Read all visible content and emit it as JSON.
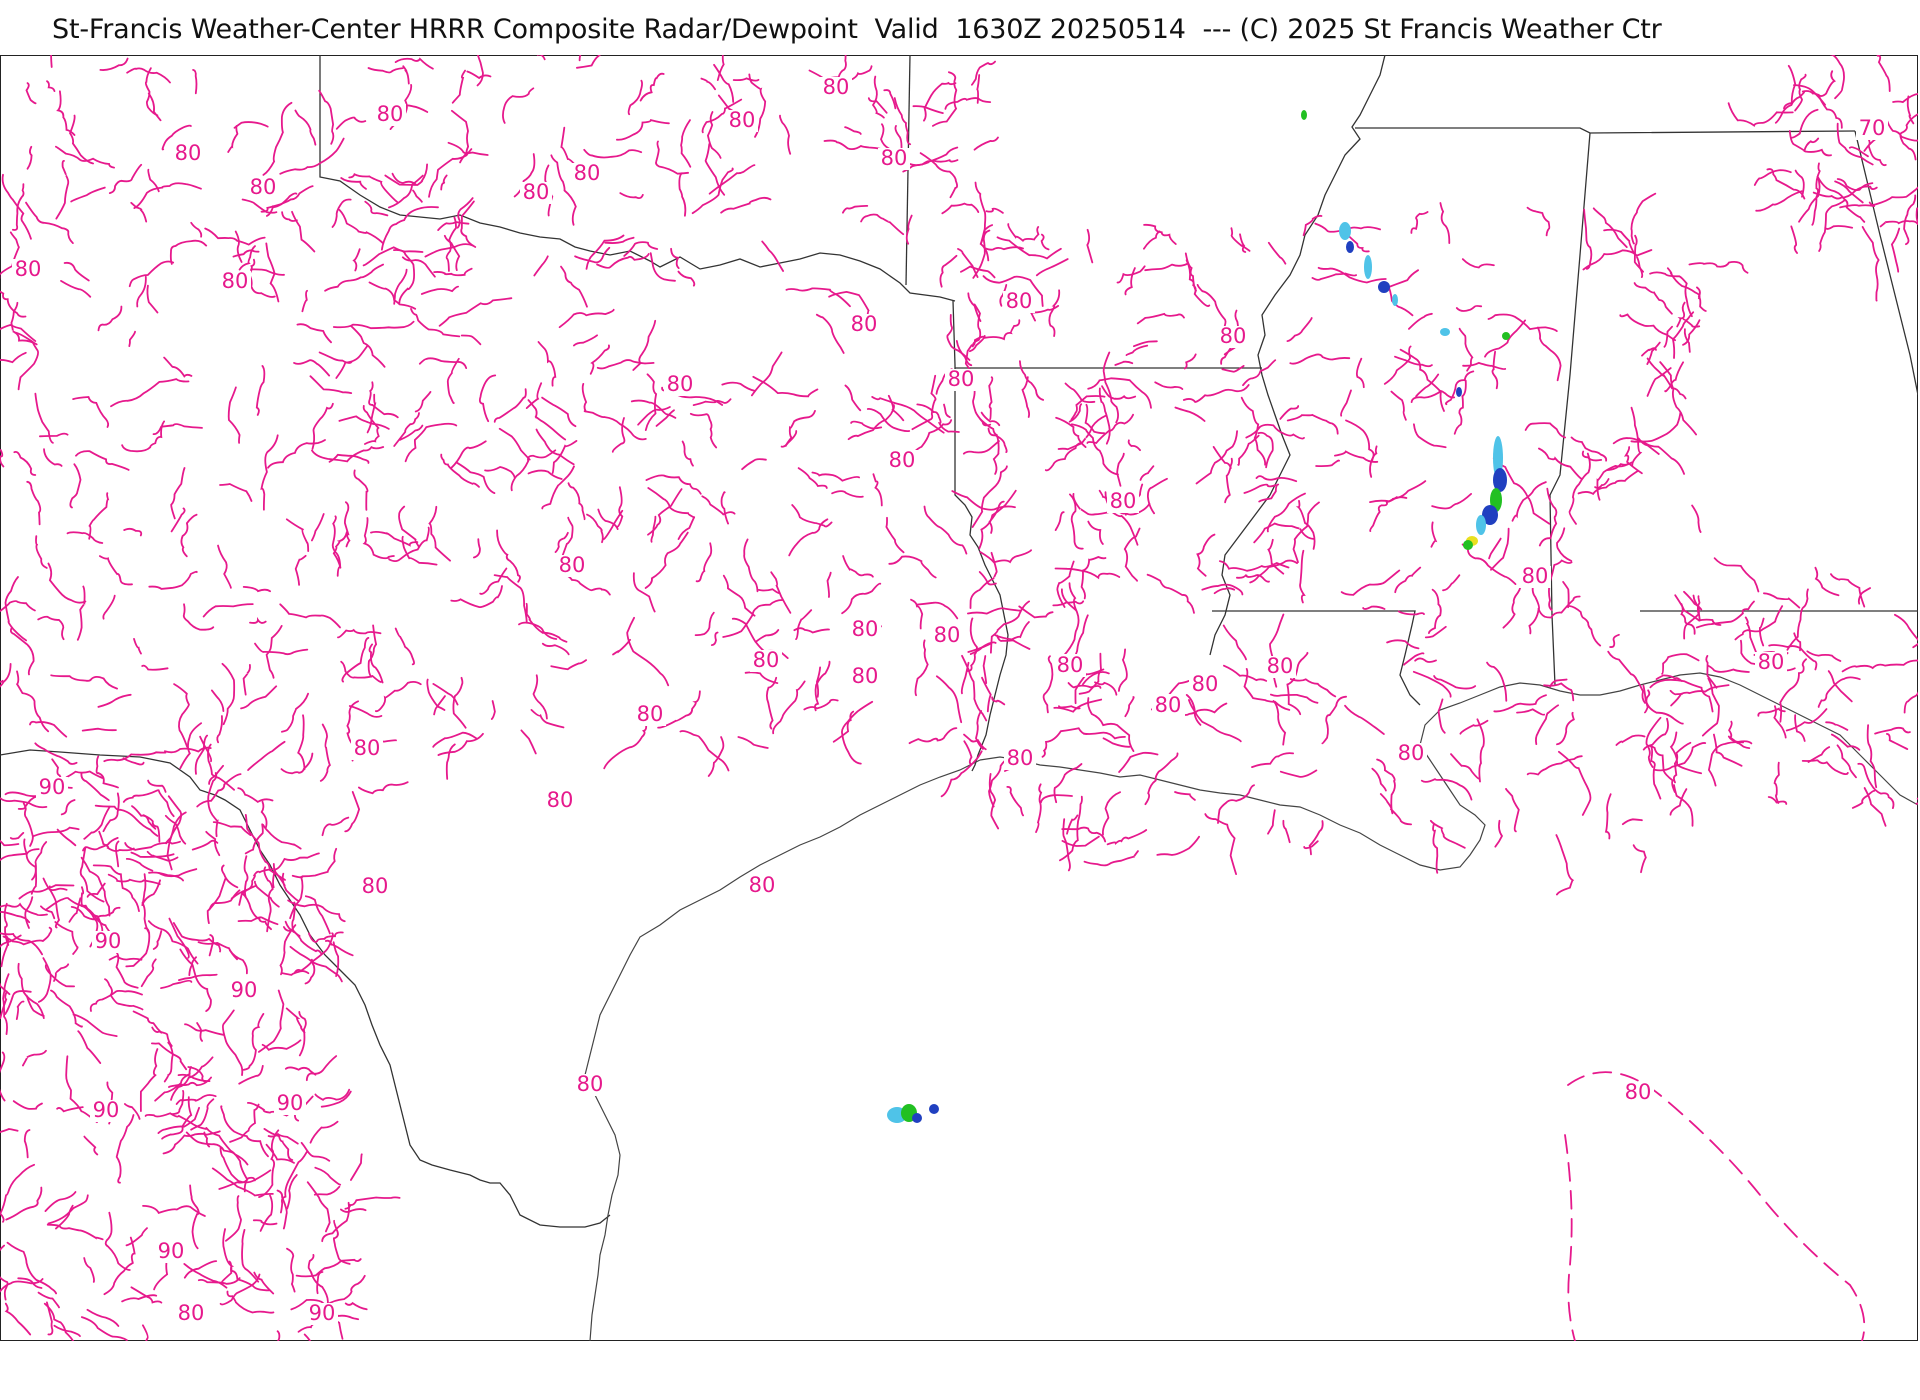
{
  "header": {
    "title": "St-Francis Weather-Center HRRR Composite Radar/Dewpoint  Valid  1630Z 20250514  --- (C) 2025 St Francis Weather Ctr"
  },
  "colors": {
    "dewpoint_contour": "#e6198c",
    "border": "#333333",
    "radar_light": "#4fc3e8",
    "radar_blue": "#2040c0",
    "radar_green": "#22c022",
    "radar_yellow": "#e8e020"
  },
  "contour_labels": [
    "80",
    "80",
    "80",
    "80",
    "80",
    "80",
    "80",
    "80",
    "80",
    "80",
    "80",
    "80",
    "80",
    "80",
    "80",
    "80",
    "80",
    "80",
    "80",
    "80",
    "80",
    "80",
    "80",
    "80",
    "80",
    "80",
    "80",
    "80",
    "80",
    "80",
    "80",
    "80",
    "80",
    "80",
    "80",
    "80",
    "80",
    "80",
    "80",
    "80",
    "90",
    "90",
    "90",
    "90",
    "90",
    "90",
    "90",
    "70"
  ]
}
